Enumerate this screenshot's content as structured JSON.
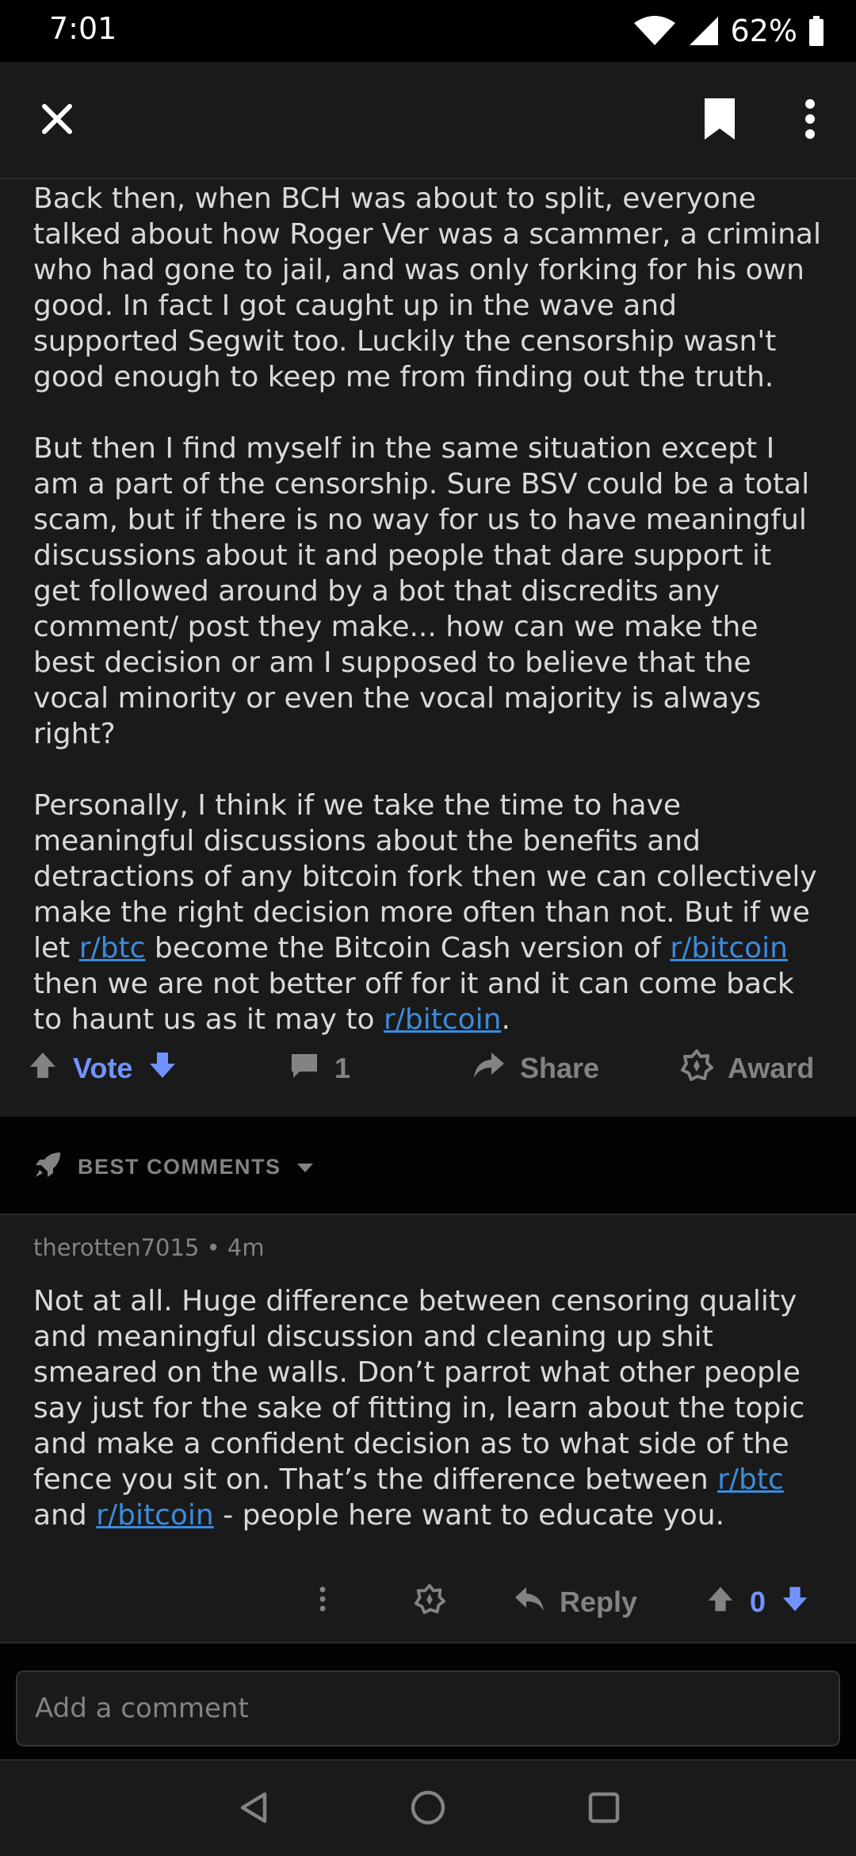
{
  "status_bar": {
    "time": "7:01",
    "battery": "62%"
  },
  "post": {
    "paragraphs": [
      [
        {
          "text": "Back then, when BCH was about to split, everyone talked about how Roger Ver was a scammer, a criminal who had gone to jail, and was only forking for his own good. In fact I got caught up in the wave and supported Segwit too.  Luckily the censorship wasn't good enough to keep me from finding out the truth."
        }
      ],
      [
        {
          "text": "But then I find myself in the same situation except I am a part of the censorship. Sure BSV could be a total scam, but if there is no way for us to have meaningful discussions about it and people that dare support it get followed around by a bot that discredits any comment/ post they make... how can we make the best decision or am I supposed to believe that the vocal minority or even the vocal majority is always right?"
        }
      ],
      [
        {
          "text": "Personally, I think if we take the time to have meaningful discussions about the benefits and detractions of any bitcoin fork then we can collectively make the right decision more often than not. But if we let "
        },
        {
          "text": "r/btc",
          "link": true
        },
        {
          "text": " become the Bitcoin Cash version of "
        },
        {
          "text": "r/bitcoin",
          "link": true
        },
        {
          "text": " then we are not better off for it and it can come back to haunt us as it may to "
        },
        {
          "text": "r/bitcoin",
          "link": true
        },
        {
          "text": "."
        }
      ]
    ],
    "actions": {
      "vote_label": "Vote",
      "comment_count": "1",
      "share_label": "Share",
      "award_label": "Award"
    }
  },
  "comments_header": {
    "sort_label": "BEST COMMENTS"
  },
  "comment": {
    "meta": "therotten7015 • 4m",
    "segments": [
      {
        "text": "Not at all. Huge difference between censoring quality and meaningful discussion and cleaning up shit smeared on the walls. Don’t parrot what other people say just for the sake of fitting in, learn about the topic and make a confident decision as to what side of the fence you sit on. That’s the difference between "
      },
      {
        "text": "r/btc",
        "link": true
      },
      {
        "text": " and "
      },
      {
        "text": "r/bitcoin",
        "link": true
      },
      {
        "text": " - people here want to educate you."
      }
    ],
    "reply_label": "Reply",
    "score": "0"
  },
  "composer": {
    "placeholder": "Add a comment"
  },
  "colors": {
    "background": "#1a1a1b",
    "text": "#d7dadc",
    "muted": "#818384",
    "link": "#3d8bd9",
    "vote_accent": "#7193ff"
  },
  "icons": {
    "top_bar": [
      "close-icon",
      "bookmark-icon",
      "more-vertical-icon"
    ],
    "post_actions": [
      "upvote-icon",
      "downvote-icon",
      "comment-icon",
      "share-icon",
      "award-icon"
    ],
    "comments_header": [
      "rocket-icon",
      "caret-down-icon"
    ],
    "comment_actions": [
      "more-vertical-icon",
      "award-icon",
      "reply-icon",
      "upvote-icon",
      "downvote-icon"
    ],
    "nav": [
      "back-icon",
      "home-icon",
      "recents-icon"
    ]
  }
}
